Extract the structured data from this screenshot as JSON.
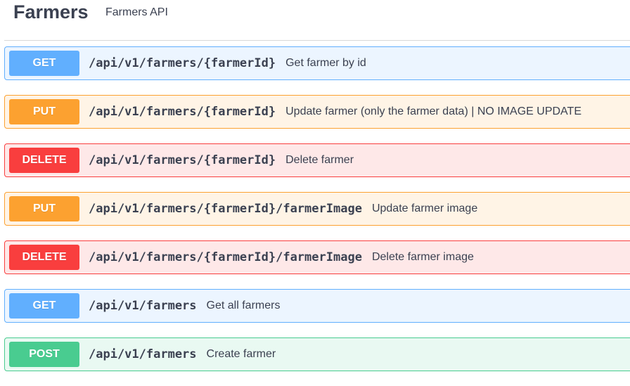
{
  "tag": {
    "title": "Farmers",
    "description": "Farmers API"
  },
  "operations": [
    {
      "method": "GET",
      "path": "/api/v1/farmers/{farmerId}",
      "summary": "Get farmer by id"
    },
    {
      "method": "PUT",
      "path": "/api/v1/farmers/{farmerId}",
      "summary": "Update farmer (only the farmer data) | NO IMAGE UPDATE"
    },
    {
      "method": "DELETE",
      "path": "/api/v1/farmers/{farmerId}",
      "summary": "Delete farmer"
    },
    {
      "method": "PUT",
      "path": "/api/v1/farmers/{farmerId}/farmerImage",
      "summary": "Update farmer image"
    },
    {
      "method": "DELETE",
      "path": "/api/v1/farmers/{farmerId}/farmerImage",
      "summary": "Delete farmer image"
    },
    {
      "method": "GET",
      "path": "/api/v1/farmers",
      "summary": "Get all farmers"
    },
    {
      "method": "POST",
      "path": "/api/v1/farmers",
      "summary": "Create farmer"
    }
  ],
  "colors": {
    "get": "#61affe",
    "put": "#fca130",
    "delete": "#f93e3e",
    "post": "#49cc90",
    "text": "#3b4151"
  }
}
